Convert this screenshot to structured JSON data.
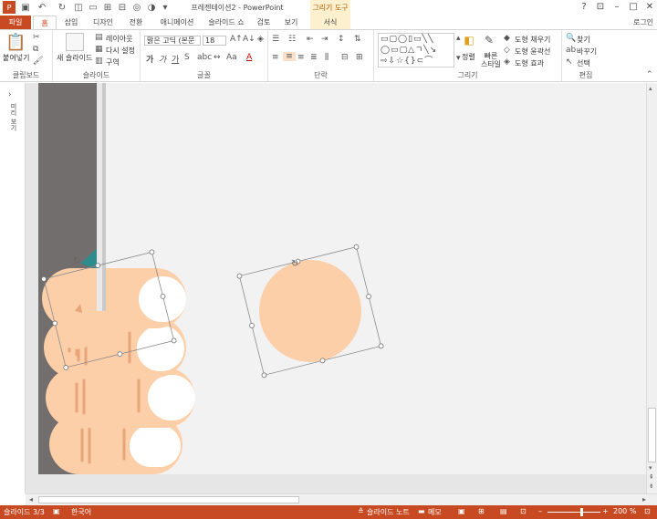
{
  "window": {
    "title": "프레젠테이션2 - PowerPoint",
    "context_tab_title": "그리기 도구",
    "account": "로그인"
  },
  "tabs": [
    {
      "label": "파일"
    },
    {
      "label": "홈"
    },
    {
      "label": "삽입"
    },
    {
      "label": "디자인"
    },
    {
      "label": "전환"
    },
    {
      "label": "애니메이션"
    },
    {
      "label": "슬라이드 쇼"
    },
    {
      "label": "검토"
    },
    {
      "label": "보기"
    },
    {
      "label": "서식"
    }
  ],
  "ribbon": {
    "clipboard": {
      "paste": "붙여넣기",
      "label": "클립보드"
    },
    "slides": {
      "new_slide": "새 슬라이드",
      "layout": "레이아웃",
      "reset": "다시 설정",
      "section": "구역",
      "label": "슬라이드"
    },
    "font": {
      "family": "맑은 고딕 (본문",
      "size": "18",
      "label": "글꼴"
    },
    "paragraph": {
      "label": "단락"
    },
    "drawing": {
      "arrange": "정렬",
      "quick_styles": "빠른 스타일",
      "fill": "도형 채우기",
      "outline": "도형 윤곽선",
      "effects": "도형 효과",
      "label": "그리기"
    },
    "editing": {
      "find": "찾기",
      "replace": "바꾸기",
      "select": "선택",
      "label": "편집"
    }
  },
  "rail": {
    "label": "미리 보기"
  },
  "status": {
    "slide": "슬라이드 3/3",
    "language": "한국어",
    "notes": "슬라이드 노트",
    "memo": "메모",
    "zoom": "200 %"
  },
  "colors": {
    "accent": "#c84a22",
    "skin": "#fdcfa8",
    "teal": "#2e8c8c",
    "panel": "#736e6e",
    "nail": "#ffffff"
  }
}
